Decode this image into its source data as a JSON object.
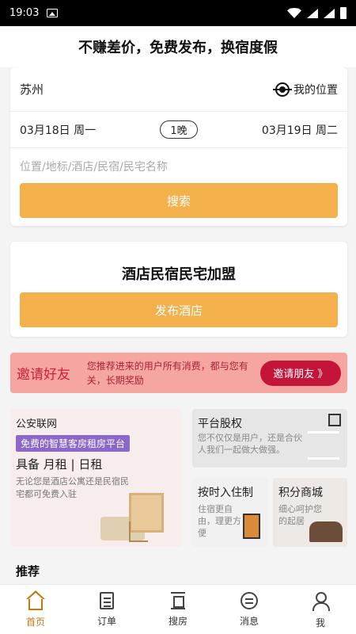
{
  "status": {
    "time": "19:03"
  },
  "header": {
    "title": "不赚差价，免费发布，换宿度假"
  },
  "search": {
    "city": "苏州",
    "my_location": "我的位置",
    "checkin": "03月18日 周一",
    "nights": "1晚",
    "checkout": "03月19日 周二",
    "keyword_placeholder": "位置/地标/酒店/民宿/民宅名称",
    "search_label": "搜索"
  },
  "join": {
    "title": "酒店民宿民宅加盟",
    "publish_label": "发布酒店"
  },
  "invite": {
    "title": "邀请好友",
    "desc": "您推荐进来的用户所有消费，都与您有关，长期奖励",
    "button": "邀请朋友 》"
  },
  "tiles": {
    "police": {
      "title": "公安联网",
      "badge": "免费的智慧客房租房平台",
      "big": "具备 月租 | 日租",
      "desc": "无论您是酒店公寓还是民宿民宅都可免费入驻"
    },
    "equity": {
      "title": "平台股权",
      "desc": "您不仅仅是用户，还是合伙人我们一起做大做强。"
    },
    "time": {
      "title": "按时入住制",
      "desc": "住宿更自由，理更方便"
    },
    "mall": {
      "title": "积分商城",
      "desc": "细心呵护您的起居"
    }
  },
  "recommend": {
    "title": "推荐"
  },
  "tabbar": {
    "items": [
      {
        "label": "首页",
        "icon": "home-icon",
        "active": true
      },
      {
        "label": "订单",
        "icon": "order-icon"
      },
      {
        "label": "搜房",
        "icon": "search-house-icon"
      },
      {
        "label": "消息",
        "icon": "message-icon"
      },
      {
        "label": "我",
        "icon": "profile-icon"
      }
    ]
  },
  "colors": {
    "accent": "#f3b04b",
    "tab_active": "#c27a16",
    "invite_bg": "#f6a6a0",
    "invite_button": "#c5143a",
    "badge": "#8b67c9"
  }
}
